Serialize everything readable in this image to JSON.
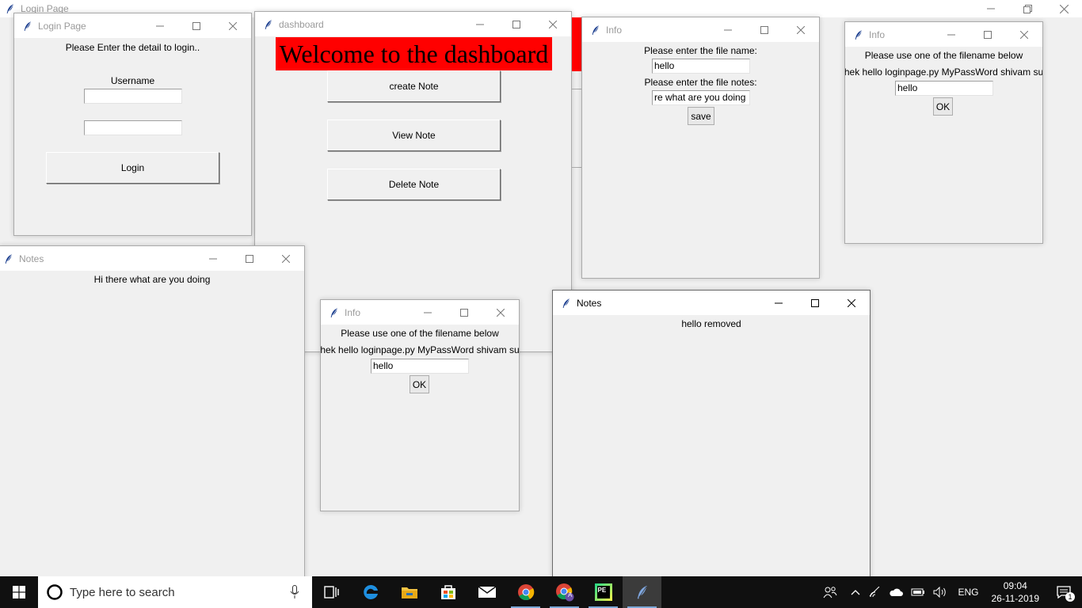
{
  "root_window": {
    "title": "Login Page"
  },
  "login_window": {
    "title": "Login Page",
    "prompt": "Please Enter the detail to login..",
    "username_label": "Username",
    "username_value": "",
    "password_value": "",
    "login_button": "Login"
  },
  "dashboard_window": {
    "title": "dashboard",
    "banner": "Welcome to the dashboard",
    "create_button": "create Note",
    "view_button": "View Note",
    "delete_button": "Delete Note"
  },
  "info_create_window": {
    "title": "Info",
    "filename_label": "Please enter the file name:",
    "filename_value": "hello",
    "notes_label": "Please enter the file notes:",
    "notes_value": "re what are you doing",
    "save_button": "save"
  },
  "info_view_window": {
    "title": "Info",
    "prompt": "Please use one of the filename below",
    "files_list": "hek hello loginpage.py MyPassWord shivam su",
    "entry_value": "hello",
    "ok_button": "OK"
  },
  "notes_view_window": {
    "title": "Notes",
    "text": "Hi there what are you doing"
  },
  "info_delete_window": {
    "title": "Info",
    "prompt": "Please use one of the filename below",
    "files_list": "hek hello loginpage.py MyPassWord shivam su",
    "entry_value": "hello",
    "ok_button": "OK"
  },
  "notes_delete_window": {
    "title": "Notes",
    "text": "hello removed"
  },
  "taskbar": {
    "search_placeholder": "Type here to search",
    "language": "ENG",
    "time": "09:04",
    "date": "26-11-2019",
    "notification_count": "1",
    "chrome_badge": "A",
    "pycharm_label": "PE",
    "icons": [
      "windows-start-icon",
      "cortana-circle-icon",
      "microphone-icon",
      "task-view-icon",
      "edge-icon",
      "file-explorer-icon",
      "store-icon",
      "mail-icon",
      "chrome-icon",
      "chrome-profile-icon",
      "pycharm-icon",
      "python-feather-icon",
      "people-icon",
      "chevron-up-icon",
      "wifi-icon",
      "cloud-icon",
      "battery-icon",
      "volume-icon",
      "action-center-icon"
    ]
  },
  "colors": {
    "banner_red": "#ff0000",
    "window_bg": "#f0f0f0",
    "taskbar": "#101010"
  }
}
